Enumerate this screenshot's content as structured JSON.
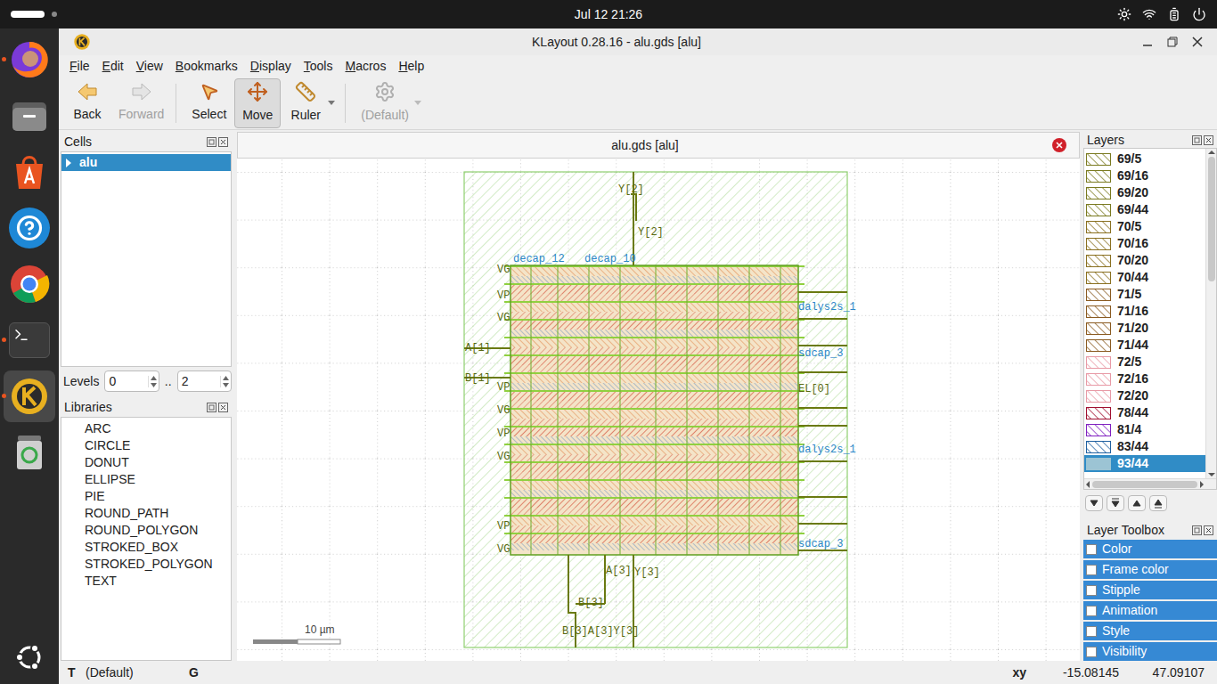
{
  "topbar": {
    "datetime": "Jul 12 21:26"
  },
  "dock": [
    {
      "kind": "firefox",
      "running": true,
      "active": false
    },
    {
      "kind": "files",
      "running": false,
      "active": false
    },
    {
      "kind": "appcenter",
      "running": false,
      "active": false
    },
    {
      "kind": "help",
      "running": false,
      "active": false
    },
    {
      "kind": "chrome",
      "running": false,
      "active": false
    },
    {
      "kind": "terminal",
      "running": true,
      "active": false
    },
    {
      "kind": "klayout",
      "running": true,
      "active": true
    },
    {
      "kind": "trash",
      "running": false,
      "active": false
    }
  ],
  "window": {
    "title": "KLayout 0.28.16 - alu.gds [alu]"
  },
  "menu": [
    "File",
    "Edit",
    "View",
    "Bookmarks",
    "Display",
    "Tools",
    "Macros",
    "Help"
  ],
  "toolbar": [
    {
      "label": "Back",
      "kind": "back",
      "disabled": false,
      "selected": false,
      "dropdown": false
    },
    {
      "label": "Forward",
      "kind": "forward",
      "disabled": true,
      "selected": false,
      "dropdown": false
    },
    {
      "label": "Select",
      "kind": "select",
      "disabled": false,
      "selected": false,
      "dropdown": false
    },
    {
      "label": "Move",
      "kind": "move",
      "disabled": false,
      "selected": true,
      "dropdown": false
    },
    {
      "label": "Ruler",
      "kind": "ruler",
      "disabled": false,
      "selected": false,
      "dropdown": true
    },
    {
      "label": "(Default)",
      "kind": "template",
      "disabled": true,
      "selected": false,
      "dropdown": true
    }
  ],
  "cells": {
    "title": "Cells",
    "items": [
      {
        "label": "alu",
        "selected": true,
        "expanded": false
      }
    ],
    "levels": {
      "label": "Levels",
      "from": "0",
      "separator": "..",
      "to": "2"
    }
  },
  "libraries": {
    "title": "Libraries",
    "items": [
      "ARC",
      "CIRCLE",
      "DONUT",
      "ELLIPSE",
      "PIE",
      "ROUND_PATH",
      "ROUND_POLYGON",
      "STROKED_BOX",
      "STROKED_POLYGON",
      "TEXT"
    ]
  },
  "canvas": {
    "tab": "alu.gds [alu]",
    "scale": "10 µm",
    "labels": [
      {
        "text": "Y[2]",
        "kind": "pin"
      },
      {
        "text": "Y[2]",
        "kind": "pin"
      },
      {
        "text": "decap_12",
        "kind": "cell"
      },
      {
        "text": "decap_10",
        "kind": "cell"
      },
      {
        "text": "A[3]",
        "kind": "pin"
      },
      {
        "text": "Y[3]",
        "kind": "pin"
      },
      {
        "text": "B[3]",
        "kind": "pin"
      },
      {
        "text": "B[3]A[3]Y[3]",
        "kind": "pin"
      },
      {
        "text": "VG",
        "kind": "pin"
      },
      {
        "text": "VP",
        "kind": "pin"
      },
      {
        "text": "VG",
        "kind": "pin"
      },
      {
        "text": "VP",
        "kind": "pin"
      },
      {
        "text": "VG",
        "kind": "pin"
      },
      {
        "text": "VP",
        "kind": "pin"
      },
      {
        "text": "VG",
        "kind": "pin"
      },
      {
        "text": "VP",
        "kind": "pin"
      },
      {
        "text": "VG",
        "kind": "pin"
      },
      {
        "text": "A[1]",
        "kind": "pin"
      },
      {
        "text": "B[1]",
        "kind": "pin"
      },
      {
        "text": "dalys2s_1",
        "kind": "cell"
      },
      {
        "text": "sdcap_3",
        "kind": "cell"
      },
      {
        "text": "EL[0]",
        "kind": "pin"
      },
      {
        "text": "dalys2s_1",
        "kind": "cell"
      },
      {
        "text": "sdcap_3",
        "kind": "cell"
      }
    ]
  },
  "layers": {
    "title": "Layers",
    "items": [
      {
        "label": "69/5",
        "color": "#7a7a20",
        "kind": "hatch",
        "selected": false
      },
      {
        "label": "69/16",
        "color": "#7a7a20",
        "kind": "hatch",
        "selected": false
      },
      {
        "label": "69/20",
        "color": "#7a7a20",
        "kind": "hatch",
        "selected": false
      },
      {
        "label": "69/44",
        "color": "#7a7a20",
        "kind": "hatch",
        "selected": false
      },
      {
        "label": "70/5",
        "color": "#8a7020",
        "kind": "hatch",
        "selected": false
      },
      {
        "label": "70/16",
        "color": "#8a7020",
        "kind": "hatch",
        "selected": false
      },
      {
        "label": "70/20",
        "color": "#8a7020",
        "kind": "hatch",
        "selected": false
      },
      {
        "label": "70/44",
        "color": "#8a7020",
        "kind": "hatch",
        "selected": false
      },
      {
        "label": "71/5",
        "color": "#8a5a20",
        "kind": "hatch",
        "selected": false
      },
      {
        "label": "71/16",
        "color": "#8a5a20",
        "kind": "hatch",
        "selected": false
      },
      {
        "label": "71/20",
        "color": "#8a5a20",
        "kind": "hatch",
        "selected": false
      },
      {
        "label": "71/44",
        "color": "#8a5a20",
        "kind": "hatch",
        "selected": false
      },
      {
        "label": "72/5",
        "color": "#e89aa6",
        "kind": "hatch",
        "selected": false
      },
      {
        "label": "72/16",
        "color": "#e89aa6",
        "kind": "hatch",
        "selected": false
      },
      {
        "label": "72/20",
        "color": "#e89aa6",
        "kind": "hatch",
        "selected": false
      },
      {
        "label": "78/44",
        "color": "#a01030",
        "kind": "hatch",
        "selected": false
      },
      {
        "label": "81/4",
        "color": "#8020c0",
        "kind": "hatch",
        "selected": false
      },
      {
        "label": "83/44",
        "color": "#2060a0",
        "kind": "hatch",
        "selected": false
      },
      {
        "label": "93/44",
        "color": "#9cc4d4",
        "kind": "solid",
        "selected": true
      }
    ]
  },
  "layer_toolbox": {
    "title": "Layer Toolbox",
    "items": [
      {
        "label": "Color",
        "checked": false
      },
      {
        "label": "Frame color",
        "checked": false
      },
      {
        "label": "Stipple",
        "checked": false
      },
      {
        "label": "Animation",
        "checked": false
      },
      {
        "label": "Style",
        "checked": false
      },
      {
        "label": "Visibility",
        "checked": false
      }
    ]
  },
  "status_bar": {
    "mode": "T",
    "template": "(Default)",
    "grid": "G",
    "coord_label": "xy",
    "x": "-15.08145",
    "y": "47.09107"
  }
}
